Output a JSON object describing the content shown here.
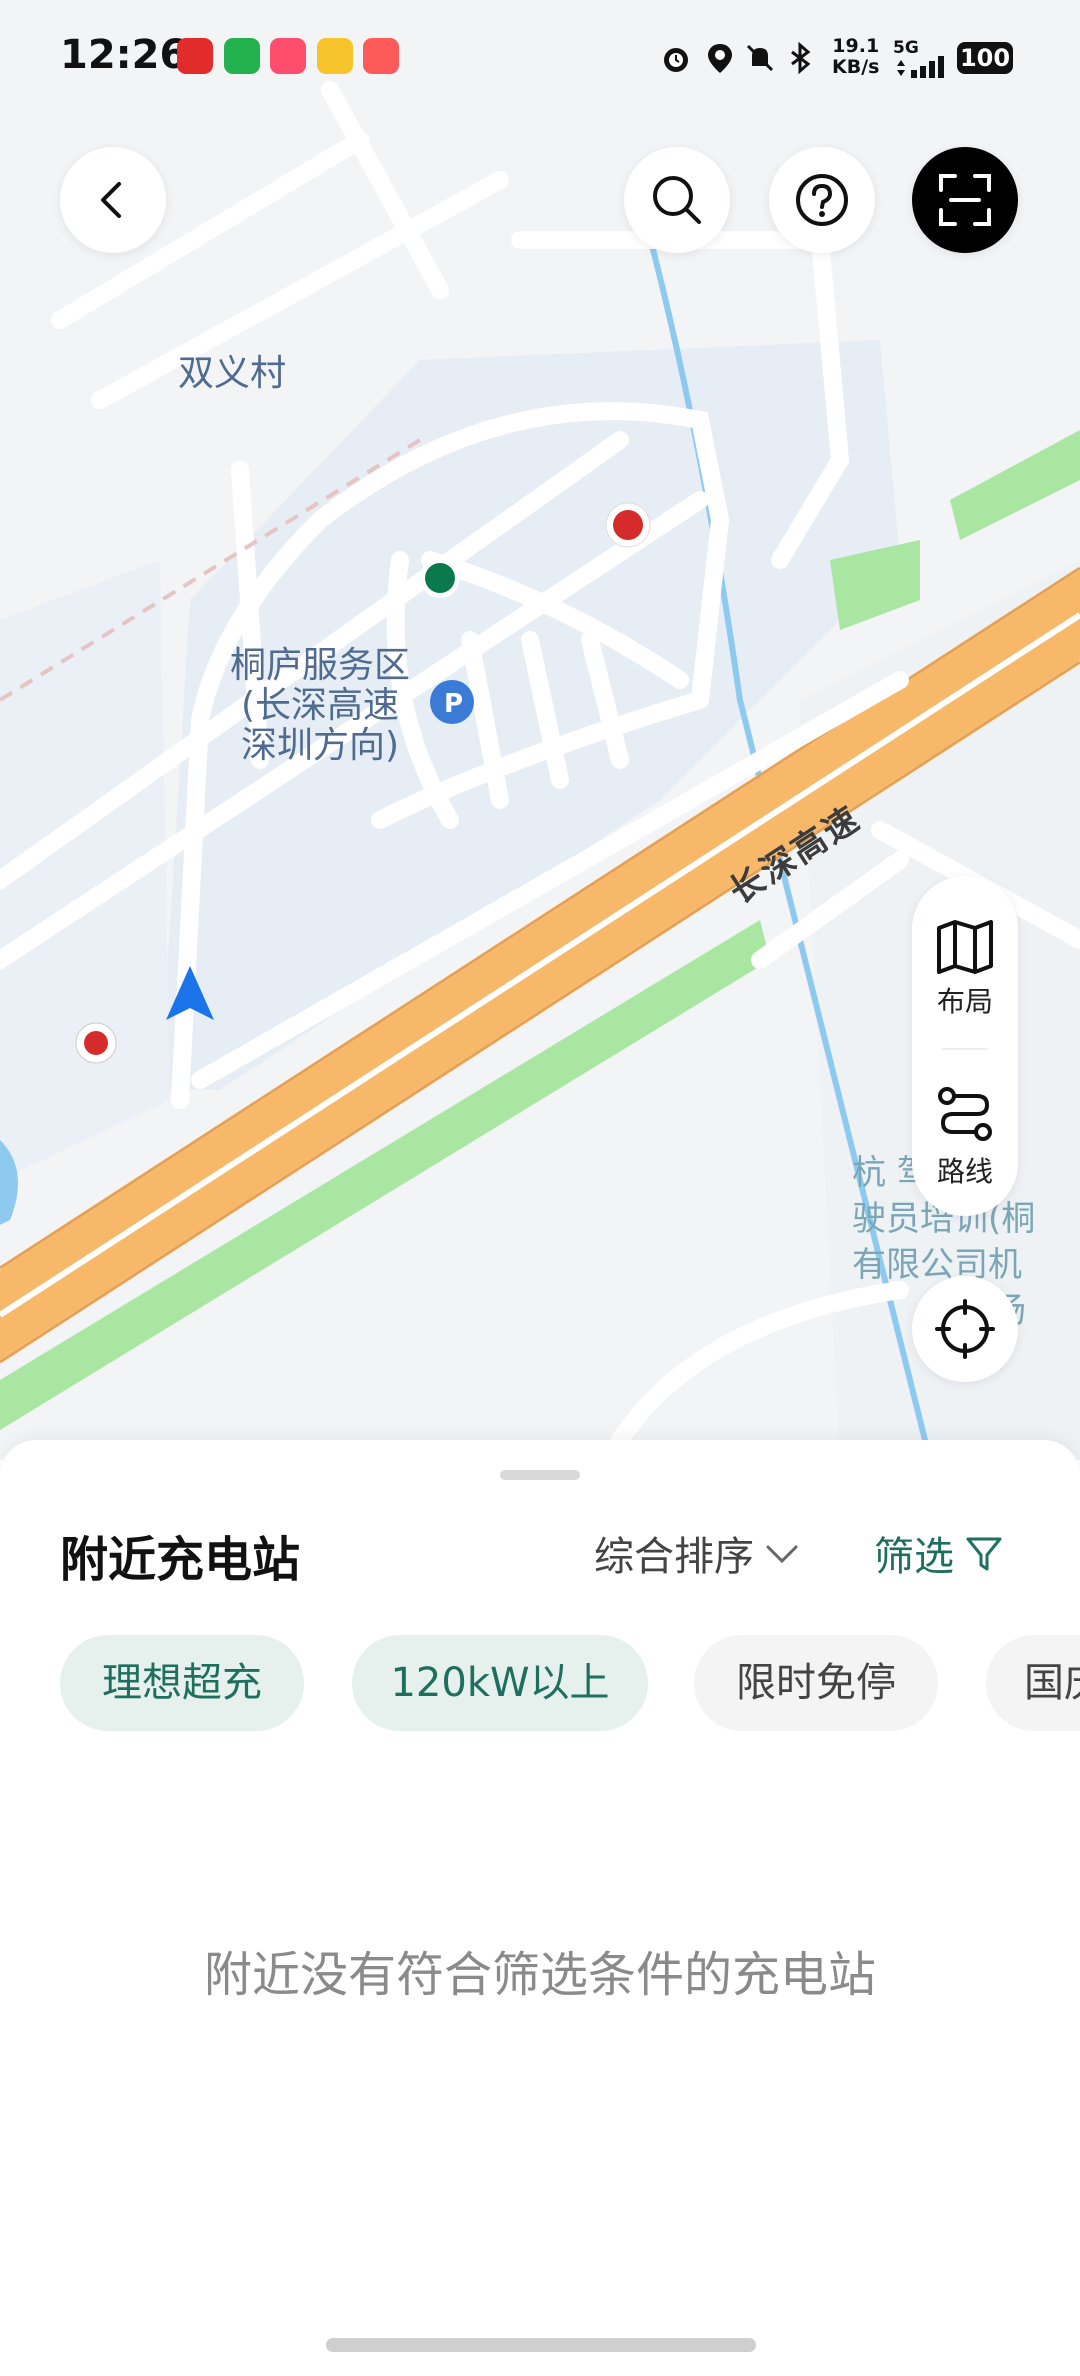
{
  "status_bar": {
    "time": "12:26",
    "net_speed_value": "19.1",
    "net_speed_unit": "KB/s",
    "signal_label": "5G",
    "battery": "100",
    "app_icons": [
      "netease-music-icon",
      "wechat-icon",
      "video-app-icon",
      "weibo-icon",
      "douyin-icon"
    ],
    "system_icons": [
      "alarm-icon",
      "location-icon",
      "mute-icon",
      "bluetooth-icon",
      "signal-icon"
    ]
  },
  "map": {
    "labels": {
      "village": "双义村",
      "service_area_line1": "桐庐服务区",
      "service_area_line2": "(长深高速",
      "service_area_line3": "深圳方向)",
      "highway": "长深高速",
      "poi_line1": "杭 驾 动",
      "poi_line2": "驶员培训(桐",
      "poi_line3": "有限公司机",
      "poi_line4": "场"
    },
    "colors": {
      "highway": "#f7b86a",
      "green": "#a8e6a1",
      "water": "#8ec9f0",
      "nav_arrow": "#1a73e8"
    }
  },
  "top_buttons": {
    "back": "back-icon",
    "search": "search-icon",
    "help": "help-icon",
    "scan": "scan-icon"
  },
  "side_panel": {
    "layout_label": "布局",
    "route_label": "路线"
  },
  "sheet": {
    "title": "附近充电站",
    "sort_label": "综合排序",
    "filter_label": "筛选",
    "chips": [
      {
        "label": "理想超充",
        "active": true
      },
      {
        "label": "120kW以上",
        "active": true
      },
      {
        "label": "限时免停",
        "active": false
      },
      {
        "label": "国庆",
        "active": false
      }
    ],
    "empty_text": "附近没有符合筛选条件的充电站"
  }
}
